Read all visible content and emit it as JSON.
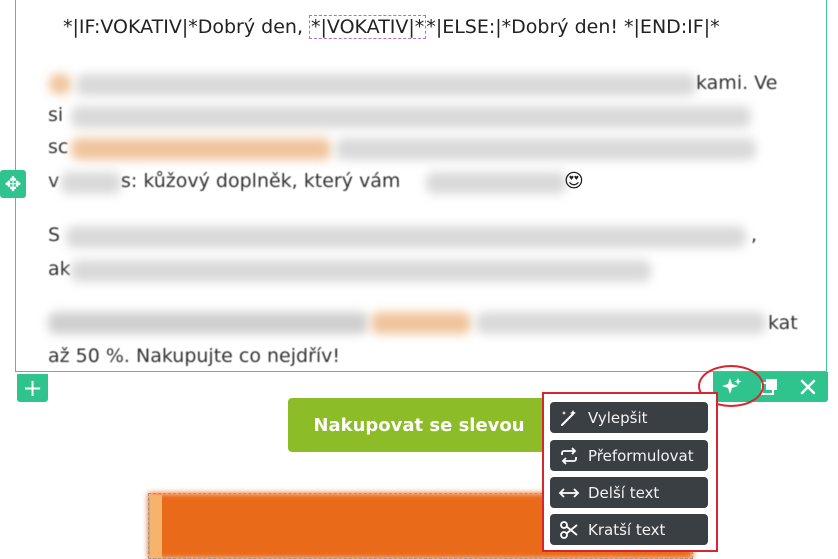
{
  "editor": {
    "merge_prefix": "*|IF:VOKATIV|*Dobrý den, ",
    "merge_tag": "*|VOKATIV|*",
    "merge_suffix": "*|ELSE:|*Dobrý den! *|END:IF|*",
    "frag_line2": "si",
    "frag_line3": "sc",
    "frag_line4a": "v",
    "frag_line4b": "s: kůžový doplněk, který vám",
    "frag_line5a": "S",
    "frag_line5b": ",",
    "frag_line6": "ak",
    "frag_line7": "kat",
    "frag_line8": "až 50 %. Nakupujte co nejdřív!",
    "frag_line1": "kami. Ve",
    "emoji": "😍"
  },
  "toolbar": {
    "add_icon": "plus-icon",
    "move_icon": "move-icon",
    "ai_icon": "sparkle-icon",
    "duplicate_icon": "duplicate-icon",
    "close_icon": "close-icon"
  },
  "cta": {
    "label": "Nakupovat se slevou"
  },
  "ai_menu": {
    "items": [
      {
        "label": "Vylepšit",
        "icon": "magic-wand-icon"
      },
      {
        "label": "Přeformulovat",
        "icon": "repeat-icon"
      },
      {
        "label": "Delší text",
        "icon": "expand-arrows-icon"
      },
      {
        "label": "Kratší text",
        "icon": "scissors-icon"
      }
    ]
  },
  "colors": {
    "accent_green": "#2fc38d",
    "cta_green": "#8cbc27",
    "highlight_red": "#d8262f",
    "menu_bg": "#3a3f44"
  }
}
